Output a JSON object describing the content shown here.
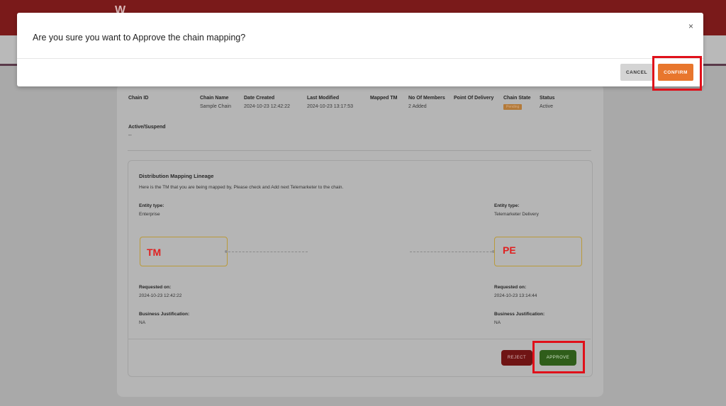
{
  "modal": {
    "title": "Are you sure you want to Approve the chain mapping?",
    "close_icon": "×",
    "cancel_label": "CANCEL",
    "confirm_label": "CONFIRM"
  },
  "background": {
    "logo_text": "W",
    "chain_fields": [
      {
        "label": "Chain ID",
        "value": ""
      },
      {
        "label": "Chain Name",
        "value": "Sample Chain"
      },
      {
        "label": "Date Created",
        "value": "2024-10-23 12:42:22"
      },
      {
        "label": "Last Modified",
        "value": "2024-10-23 13:17:53"
      },
      {
        "label": "Mapped TM",
        "value": ""
      },
      {
        "label": "No Of Members",
        "value": "2 Added"
      },
      {
        "label": "Point Of Delivery",
        "value": ""
      },
      {
        "label": "Chain State",
        "value": "Pending"
      },
      {
        "label": "Status",
        "value": "Active"
      }
    ],
    "active_suspend": {
      "label": "Active/Suspend",
      "value": "--"
    },
    "lineage": {
      "title": "Distribution Mapping Lineage",
      "description": "Here is the TM that you are being mapped by, Please check and Add next Telemarketer to the chain.",
      "left": {
        "entity_label": "Entity type:",
        "entity_value": "Enterprise",
        "node_label": "TM",
        "requested_label": "Requested on:",
        "requested_value": "2024-10-23 12:42:22",
        "justification_label": "Business Justification:",
        "justification_value": "NA"
      },
      "right": {
        "entity_label": "Entity type:",
        "entity_value": "Telemarketer Delivery",
        "node_label": "PE",
        "requested_label": "Requested on:",
        "requested_value": "2024-10-23 13:14:44",
        "justification_label": "Business Justification:",
        "justification_value": "NA"
      }
    },
    "reject_label": "REJECT",
    "approve_label": "APPROVE"
  },
  "colors": {
    "confirm": "#e8762d",
    "approve": "#2f5d1a",
    "reject": "#6f1414",
    "highlight": "#e0101a"
  }
}
